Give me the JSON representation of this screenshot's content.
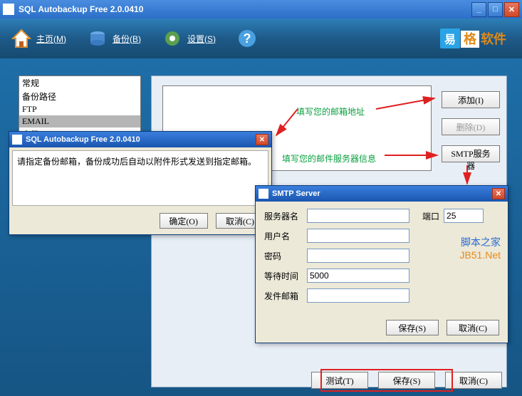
{
  "window": {
    "title": "SQL Autobackup Free 2.0.0410"
  },
  "toolbar": {
    "home": "主页(M)",
    "backup": "备份(B)",
    "settings": "设置(S)"
  },
  "logo": {
    "yi": "易",
    "ge": "格",
    "soft": "软件"
  },
  "tree": {
    "items": [
      "常规",
      "备份路径",
      "FTP",
      "EMAIL",
      "高级"
    ],
    "selected_index": 3
  },
  "side": {
    "add": "添加(I)",
    "delete": "删除(D)",
    "smtp": "SMTP服务器"
  },
  "dialog1": {
    "title": "SQL Autobackup Free 2.0.0410",
    "message": "请指定备份邮箱，备份成功后自动以附件形式发送到指定邮箱。",
    "ok": "确定(O)",
    "cancel": "取消(C)"
  },
  "dialog2": {
    "title": "SMTP Server",
    "server_lbl": "服务器名",
    "port_lbl": "端口",
    "port_val": "25",
    "user_lbl": "用户名",
    "pass_lbl": "密码",
    "wait_lbl": "等待时间",
    "wait_val": "5000",
    "sender_lbl": "发件邮箱",
    "save": "保存(S)",
    "cancel": "取消(C)"
  },
  "bottom": {
    "test": "测试(T)",
    "save": "保存(S)",
    "cancel": "取消(C)"
  },
  "annotations": {
    "anno1": "填写您的邮箱地址",
    "anno2": "填写您的邮件服务器信息"
  },
  "watermark": {
    "line1": "脚本之家",
    "line2": "JB51.Net"
  }
}
